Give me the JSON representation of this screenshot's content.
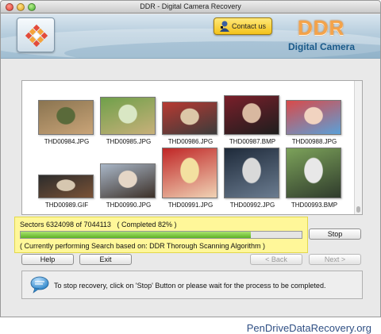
{
  "window": {
    "title": "DDR - Digital Camera Recovery"
  },
  "header": {
    "contact_label": "Contact us",
    "brand": "DDR",
    "subbrand": "Digital Camera"
  },
  "files": [
    {
      "name": "THD00984.JPG",
      "colors": [
        "#8a7450",
        "#c9a478",
        "#5a6a3a"
      ]
    },
    {
      "name": "THD00985.JPG",
      "colors": [
        "#6fa04a",
        "#c8b07a",
        "#d9e7c4"
      ]
    },
    {
      "name": "THD00986.JPG",
      "colors": [
        "#b83a32",
        "#3b3b3b",
        "#dcc7a8"
      ]
    },
    {
      "name": "THD00987.BMP",
      "colors": [
        "#7a1f2a",
        "#1e1e1e",
        "#d8b8a0"
      ]
    },
    {
      "name": "THD00988.JPG",
      "colors": [
        "#d94a4a",
        "#5aa0d8",
        "#f1d3c0"
      ]
    },
    {
      "name": "THD00989.GIF",
      "colors": [
        "#2c2c2c",
        "#7a5236",
        "#d6c7b0"
      ]
    },
    {
      "name": "THD00990.JPG",
      "colors": [
        "#a9b7c8",
        "#3c3028",
        "#e5d6c6"
      ]
    },
    {
      "name": "THD00991.JPG",
      "colors": [
        "#c02626",
        "#f0d3b5",
        "#f3e0a0"
      ]
    },
    {
      "name": "THD00992.JPG",
      "colors": [
        "#1e2a3a",
        "#6b7c90",
        "#d9d9d9"
      ]
    },
    {
      "name": "THD00993.BMP",
      "colors": [
        "#7ca25a",
        "#2f3b2c",
        "#e8e8e8"
      ]
    }
  ],
  "progress": {
    "sectors_text": "Sectors 6324098 of 7044113",
    "completed_text": "( Completed 82% )",
    "percent": 82,
    "scan_text": "( Currently performing Search based on: DDR Thorough Scanning Algorithm )"
  },
  "buttons": {
    "stop": "Stop",
    "help": "Help",
    "exit": "Exit",
    "back": "< Back",
    "next": "Next >"
  },
  "info": {
    "message": "To stop recovery, click on 'Stop' Button or please wait for the process to be completed."
  },
  "footer": {
    "site": "PenDriveDataRecovery.org"
  },
  "colors": {
    "progress_highlight": "#fff799",
    "progress_fill": "#5eb226",
    "brand_orange": "#f4a34a",
    "brand_blue": "#1a5a8a",
    "footer_text": "#2f4f84"
  }
}
